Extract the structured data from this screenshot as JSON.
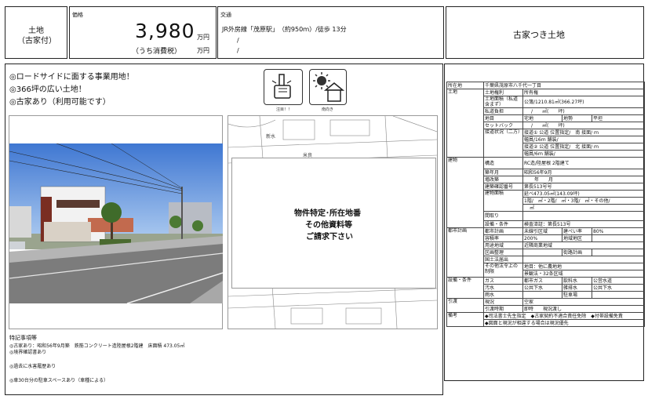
{
  "header": {
    "type_line1": "土地",
    "type_line2": "（古家付）",
    "price_label": "価格",
    "price": "3,980",
    "price_unit": "万円",
    "tax_label": "（うち消費税）",
    "tax_unit": "万円",
    "transport_label": "交通",
    "transport_line1": "JR外房線「茂原駅」　（約950ｍ）/徒歩 13分",
    "transport_line2": "/",
    "transport_line3": "/",
    "title": "古家つき土地"
  },
  "catch": [
    "◎ロードサイドに面する事業用地！",
    "◎366坪の広い土地！",
    "◎古家あり（利用可能です）"
  ],
  "icons": {
    "attention_caption": "注目！！",
    "south_caption": "南向き"
  },
  "map_notice": [
    "物件特定･所在地番",
    "その他資料等",
    "ご請求下さい"
  ],
  "map_labels": {
    "street1": "新水",
    "street2": "米良"
  },
  "notes": {
    "title": "特記事項等",
    "lines": [
      "◎古家あり：昭和56年9月築　鉄筋コンクリート造陸屋根2階建　床面積 473.05㎡",
      "◎境界確認書あり",
      "◎過去に水害履歴あり",
      "◎車30台分の駐車スペースあり（車種による）"
    ]
  },
  "spec": {
    "location_label": "所在地",
    "location": "千葉県茂原市八千代一丁目",
    "land": "土地",
    "rights_label": "土地権利",
    "rights": "所有権",
    "area_label": "土地面積（私道含まず）",
    "area": "公簿/1210.81㎡(366.27坪)",
    "private_road_label": "私道負担",
    "private_road": "/　　㎡(　　坪)",
    "chimoku_label": "地目",
    "chimoku": "宅地",
    "terrain_label": "地勢",
    "terrain": "平坦",
    "setback_label": "セットバック",
    "setback": "/　　㎡(　　坪)",
    "road_label": "接道状況（二方）",
    "road1a": "接道① 公道 位置指定/　南 接面/ ｍ",
    "road1b": "幅員/16ｍ 舗装/",
    "road2a": "接道② 公道 位置指定/　北 接面/ ｍ",
    "road2b": "幅員/6ｍ 舗装/",
    "building": "建物",
    "structure_label": "構造",
    "structure": "RC造/陸屋根 2階建て",
    "built_label": "築年月",
    "built": "昭和56年9月",
    "extension_label": "増改築",
    "extension": "年　　月",
    "permit_label": "建築確認番号",
    "permit": "第長513号号",
    "floor_label": "建物面積",
    "floor1": "延べ473.05㎡(143.09坪)",
    "floor2": "1階/　㎡・2階/　㎡・3階/　㎡・その他/",
    "floor3": "㎡",
    "layout_label": "間取り",
    "layout": "",
    "equip_label": "設備・条件",
    "equip": "検査済証：第長513号",
    "city": "都市計画",
    "city_plan_label": "都市計画",
    "city_plan": "未線引区域",
    "bcr_label": "建ぺい率",
    "bcr": "80%",
    "far_label": "容積率",
    "far": "200%",
    "district_label": "地域地区",
    "district": "",
    "zone_label": "用途地域",
    "zone": "近隣商業地域",
    "readjust_label": "区画整理",
    "readjust": "",
    "street_plan_label": "街路計画",
    "street_plan": "",
    "nat_park_label": "国土法届出",
    "nat_park": "",
    "other_label": "その他法令上の制限",
    "other1": "地目：他に農地地",
    "other2": "景観法・32条区域",
    "facility": "設備・条件",
    "gas_label": "ガス",
    "gas": "都市ガス",
    "water_label": "飲料水",
    "water": "公営水道",
    "sewage_label": "汚水",
    "sewage": "公共下水",
    "misc_label": "雑排水",
    "misc": "公共下水",
    "rain_label": "雨水",
    "rain": "",
    "parking_label": "駐車場",
    "parking": "",
    "delivery": "引渡",
    "status_label": "現況",
    "status": "空家",
    "handover_label": "引渡時期",
    "handover": "即時　　現況渡し",
    "remarks_label": "備考",
    "remark1": "◆司法書士先生指定　◆古家契約不適合責任免除　◆付帯設備免責",
    "remark2": "◆図面と現況が相違する場合は現況優先"
  },
  "colors": {
    "sky": "#5b8fd6",
    "road": "#7c7c7c",
    "building": "#8a3a2a"
  }
}
